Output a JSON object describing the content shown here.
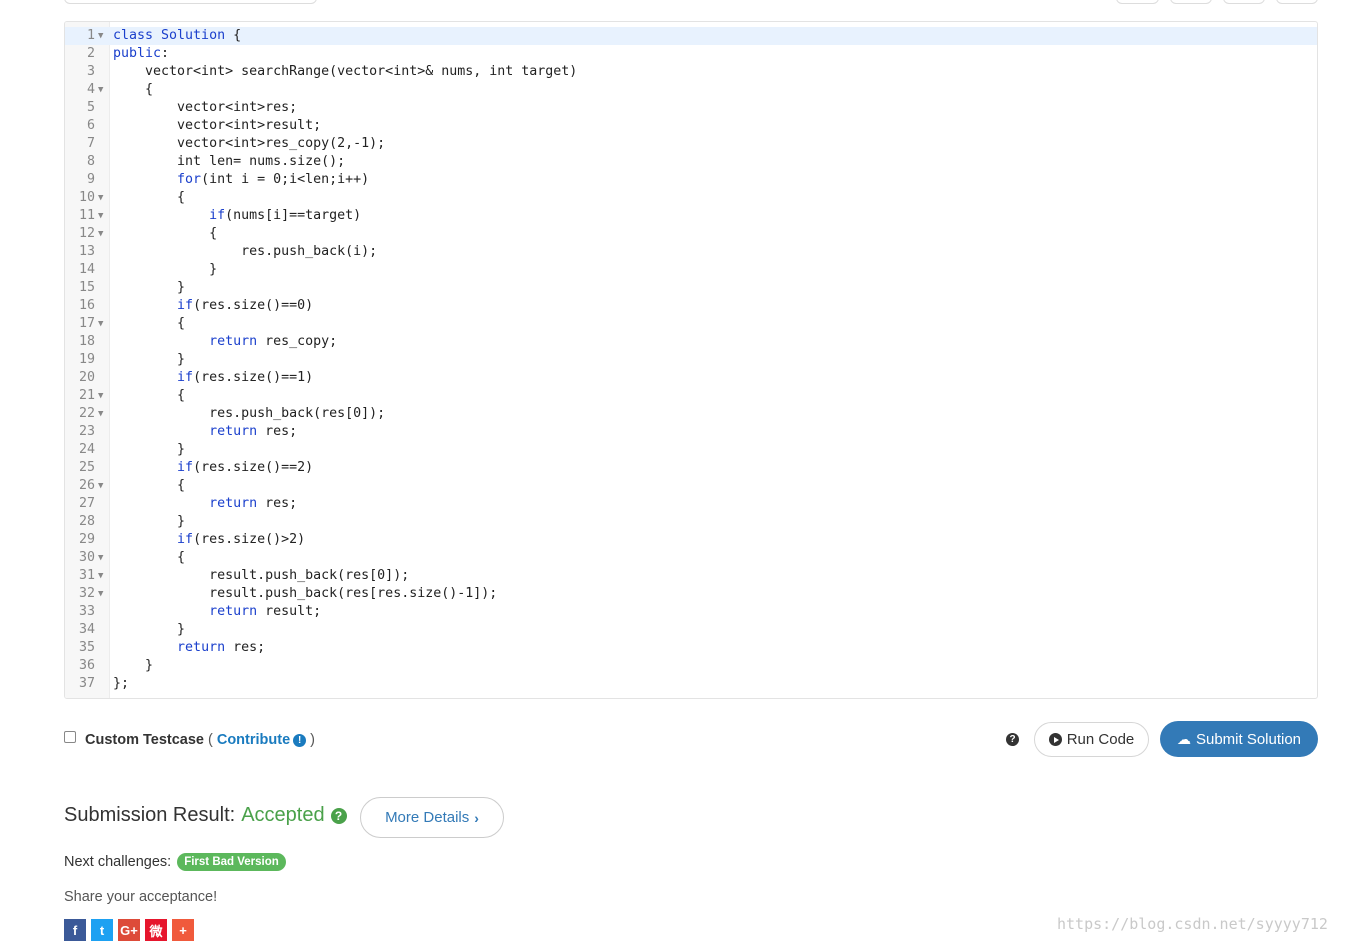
{
  "editor": {
    "lines": [
      {
        "n": "1",
        "fold": true,
        "segs": [
          {
            "t": "class Solution",
            "k": 1
          },
          {
            "t": " {"
          }
        ]
      },
      {
        "n": "2",
        "fold": false,
        "segs": [
          {
            "t": "public",
            "k": 1
          },
          {
            "t": ":"
          }
        ]
      },
      {
        "n": "3",
        "fold": false,
        "segs": [
          {
            "t": "    vector<int> searchRange(vector<int>& nums, int target)"
          }
        ]
      },
      {
        "n": "4",
        "fold": true,
        "segs": [
          {
            "t": "    {"
          }
        ]
      },
      {
        "n": "5",
        "fold": false,
        "segs": [
          {
            "t": "        vector<int>res;"
          }
        ]
      },
      {
        "n": "6",
        "fold": false,
        "segs": [
          {
            "t": "        vector<int>result;"
          }
        ]
      },
      {
        "n": "7",
        "fold": false,
        "segs": [
          {
            "t": "        vector<int>res_copy(2,-1);"
          }
        ]
      },
      {
        "n": "8",
        "fold": false,
        "segs": [
          {
            "t": "        int len= nums.size();"
          }
        ]
      },
      {
        "n": "9",
        "fold": false,
        "segs": [
          {
            "t": "        "
          },
          {
            "t": "for",
            "k": 1
          },
          {
            "t": "(int i = 0;i<len;i++)"
          }
        ]
      },
      {
        "n": "10",
        "fold": true,
        "segs": [
          {
            "t": "        {"
          }
        ]
      },
      {
        "n": "11",
        "fold": true,
        "segs": [
          {
            "t": "            "
          },
          {
            "t": "if",
            "k": 1
          },
          {
            "t": "(nums[i]==target)"
          }
        ]
      },
      {
        "n": "12",
        "fold": true,
        "segs": [
          {
            "t": "            {"
          }
        ]
      },
      {
        "n": "13",
        "fold": false,
        "segs": [
          {
            "t": "                res.push_back(i);"
          }
        ]
      },
      {
        "n": "14",
        "fold": false,
        "segs": [
          {
            "t": "            }"
          }
        ]
      },
      {
        "n": "15",
        "fold": false,
        "segs": [
          {
            "t": "        }"
          }
        ]
      },
      {
        "n": "16",
        "fold": false,
        "segs": [
          {
            "t": "        "
          },
          {
            "t": "if",
            "k": 1
          },
          {
            "t": "(res.size()==0)"
          }
        ]
      },
      {
        "n": "17",
        "fold": true,
        "segs": [
          {
            "t": "        {"
          }
        ]
      },
      {
        "n": "18",
        "fold": false,
        "segs": [
          {
            "t": "            "
          },
          {
            "t": "return",
            "k": 1
          },
          {
            "t": " res_copy;"
          }
        ]
      },
      {
        "n": "19",
        "fold": false,
        "segs": [
          {
            "t": "        }"
          }
        ]
      },
      {
        "n": "20",
        "fold": false,
        "segs": [
          {
            "t": "        "
          },
          {
            "t": "if",
            "k": 1
          },
          {
            "t": "(res.size()==1)"
          }
        ]
      },
      {
        "n": "21",
        "fold": true,
        "segs": [
          {
            "t": "        {"
          }
        ]
      },
      {
        "n": "22",
        "fold": true,
        "segs": [
          {
            "t": "            res.push_back(res[0]);"
          }
        ]
      },
      {
        "n": "23",
        "fold": false,
        "segs": [
          {
            "t": "            "
          },
          {
            "t": "return",
            "k": 1
          },
          {
            "t": " res;"
          }
        ]
      },
      {
        "n": "24",
        "fold": false,
        "segs": [
          {
            "t": "        }"
          }
        ]
      },
      {
        "n": "25",
        "fold": false,
        "segs": [
          {
            "t": "        "
          },
          {
            "t": "if",
            "k": 1
          },
          {
            "t": "(res.size()==2)"
          }
        ]
      },
      {
        "n": "26",
        "fold": true,
        "segs": [
          {
            "t": "        {"
          }
        ]
      },
      {
        "n": "27",
        "fold": false,
        "segs": [
          {
            "t": "            "
          },
          {
            "t": "return",
            "k": 1
          },
          {
            "t": " res;"
          }
        ]
      },
      {
        "n": "28",
        "fold": false,
        "segs": [
          {
            "t": "        }"
          }
        ]
      },
      {
        "n": "29",
        "fold": false,
        "segs": [
          {
            "t": "        "
          },
          {
            "t": "if",
            "k": 1
          },
          {
            "t": "(res.size()>2)"
          }
        ]
      },
      {
        "n": "30",
        "fold": true,
        "segs": [
          {
            "t": "        {"
          }
        ]
      },
      {
        "n": "31",
        "fold": true,
        "segs": [
          {
            "t": "            result.push_back(res[0]);"
          }
        ]
      },
      {
        "n": "32",
        "fold": true,
        "segs": [
          {
            "t": "            result.push_back(res[res.size()-1]);"
          }
        ]
      },
      {
        "n": "33",
        "fold": false,
        "segs": [
          {
            "t": "            "
          },
          {
            "t": "return",
            "k": 1
          },
          {
            "t": " result;"
          }
        ]
      },
      {
        "n": "34",
        "fold": false,
        "segs": [
          {
            "t": "        }"
          }
        ]
      },
      {
        "n": "35",
        "fold": false,
        "segs": [
          {
            "t": "        "
          },
          {
            "t": "return",
            "k": 1
          },
          {
            "t": " res;"
          }
        ]
      },
      {
        "n": "36",
        "fold": false,
        "segs": [
          {
            "t": "    }"
          }
        ]
      },
      {
        "n": "37",
        "fold": false,
        "segs": [
          {
            "t": "};"
          }
        ]
      }
    ]
  },
  "testcase": {
    "label": "Custom Testcase",
    "open_paren": "(",
    "contribute": "Contribute",
    "close_paren": ")"
  },
  "actions": {
    "help_icon": "question-circle-icon",
    "run_label": "Run Code",
    "submit_label": "Submit Solution"
  },
  "result": {
    "label": "Submission Result:",
    "status": "Accepted",
    "more_label": "More Details",
    "status_color": "#4aa14a"
  },
  "next": {
    "label": "Next challenges:",
    "badge": "First Bad Version"
  },
  "share": {
    "label": "Share your acceptance!",
    "icons": [
      {
        "name": "facebook-icon",
        "glyph": "f",
        "color": "#3b5998"
      },
      {
        "name": "twitter-icon",
        "glyph": "t",
        "color": "#1da1f2"
      },
      {
        "name": "google-plus-icon",
        "glyph": "G+",
        "color": "#dd4b39"
      },
      {
        "name": "weibo-icon",
        "glyph": "微",
        "color": "#e6162d"
      },
      {
        "name": "more-share-icon",
        "glyph": "+",
        "color": "#f05a3c"
      }
    ]
  },
  "watermark": "https://blog.csdn.net/syyyy712",
  "colors": {
    "accent": "#337ab7",
    "success": "#5cb85c",
    "keyword": "#1a3fcc"
  }
}
